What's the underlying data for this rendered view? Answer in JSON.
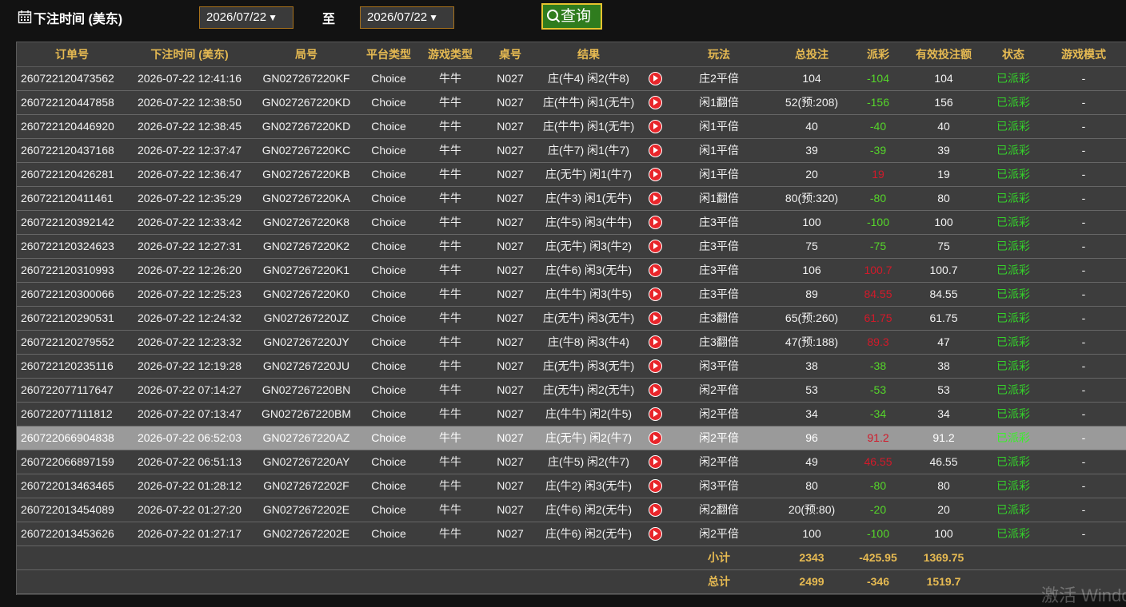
{
  "filter": {
    "label": "下注时间 (美东)",
    "start_date": "2026/07/22",
    "end_date": "2026/07/22",
    "to_label": "至",
    "query_label": "查询"
  },
  "table": {
    "headers": [
      "订单号",
      "下注时间 (美东)",
      "局号",
      "平台类型",
      "游戏类型",
      "桌号",
      "结果",
      "",
      "玩法",
      "总投注",
      "派彩",
      "有效投注额",
      "状态",
      "游戏模式"
    ],
    "rows": [
      {
        "order": "260722120473562",
        "time": "2026-07-22 12:41:16",
        "round": "GN027267220KF",
        "platform": "Choice",
        "game": "牛牛",
        "table": "N027",
        "result": "庄(牛4) 闲2(牛8)",
        "play": "庄2平倍",
        "bet": "104",
        "payout": "-104",
        "payout_color": "green",
        "valid": "104",
        "status": "已派彩",
        "mode": "-"
      },
      {
        "order": "260722120447858",
        "time": "2026-07-22 12:38:50",
        "round": "GN027267220KD",
        "platform": "Choice",
        "game": "牛牛",
        "table": "N027",
        "result": "庄(牛牛) 闲1(无牛)",
        "play": "闲1翻倍",
        "bet": "52(预:208)",
        "payout": "-156",
        "payout_color": "green",
        "valid": "156",
        "status": "已派彩",
        "mode": "-"
      },
      {
        "order": "260722120446920",
        "time": "2026-07-22 12:38:45",
        "round": "GN027267220KD",
        "platform": "Choice",
        "game": "牛牛",
        "table": "N027",
        "result": "庄(牛牛) 闲1(无牛)",
        "play": "闲1平倍",
        "bet": "40",
        "payout": "-40",
        "payout_color": "green",
        "valid": "40",
        "status": "已派彩",
        "mode": "-"
      },
      {
        "order": "260722120437168",
        "time": "2026-07-22 12:37:47",
        "round": "GN027267220KC",
        "platform": "Choice",
        "game": "牛牛",
        "table": "N027",
        "result": "庄(牛7) 闲1(牛7)",
        "play": "闲1平倍",
        "bet": "39",
        "payout": "-39",
        "payout_color": "green",
        "valid": "39",
        "status": "已派彩",
        "mode": "-"
      },
      {
        "order": "260722120426281",
        "time": "2026-07-22 12:36:47",
        "round": "GN027267220KB",
        "platform": "Choice",
        "game": "牛牛",
        "table": "N027",
        "result": "庄(无牛) 闲1(牛7)",
        "play": "闲1平倍",
        "bet": "20",
        "payout": "19",
        "payout_color": "red",
        "valid": "19",
        "status": "已派彩",
        "mode": "-"
      },
      {
        "order": "260722120411461",
        "time": "2026-07-22 12:35:29",
        "round": "GN027267220KA",
        "platform": "Choice",
        "game": "牛牛",
        "table": "N027",
        "result": "庄(牛3) 闲1(无牛)",
        "play": "闲1翻倍",
        "bet": "80(预:320)",
        "payout": "-80",
        "payout_color": "green",
        "valid": "80",
        "status": "已派彩",
        "mode": "-"
      },
      {
        "order": "260722120392142",
        "time": "2026-07-22 12:33:42",
        "round": "GN027267220K8",
        "platform": "Choice",
        "game": "牛牛",
        "table": "N027",
        "result": "庄(牛5) 闲3(牛牛)",
        "play": "庄3平倍",
        "bet": "100",
        "payout": "-100",
        "payout_color": "green",
        "valid": "100",
        "status": "已派彩",
        "mode": "-"
      },
      {
        "order": "260722120324623",
        "time": "2026-07-22 12:27:31",
        "round": "GN027267220K2",
        "platform": "Choice",
        "game": "牛牛",
        "table": "N027",
        "result": "庄(无牛) 闲3(牛2)",
        "play": "庄3平倍",
        "bet": "75",
        "payout": "-75",
        "payout_color": "green",
        "valid": "75",
        "status": "已派彩",
        "mode": "-"
      },
      {
        "order": "260722120310993",
        "time": "2026-07-22 12:26:20",
        "round": "GN027267220K1",
        "platform": "Choice",
        "game": "牛牛",
        "table": "N027",
        "result": "庄(牛6) 闲3(无牛)",
        "play": "庄3平倍",
        "bet": "106",
        "payout": "100.7",
        "payout_color": "red",
        "valid": "100.7",
        "status": "已派彩",
        "mode": "-"
      },
      {
        "order": "260722120300066",
        "time": "2026-07-22 12:25:23",
        "round": "GN027267220K0",
        "platform": "Choice",
        "game": "牛牛",
        "table": "N027",
        "result": "庄(牛牛) 闲3(牛5)",
        "play": "庄3平倍",
        "bet": "89",
        "payout": "84.55",
        "payout_color": "red",
        "valid": "84.55",
        "status": "已派彩",
        "mode": "-"
      },
      {
        "order": "260722120290531",
        "time": "2026-07-22 12:24:32",
        "round": "GN027267220JZ",
        "platform": "Choice",
        "game": "牛牛",
        "table": "N027",
        "result": "庄(无牛) 闲3(无牛)",
        "play": "庄3翻倍",
        "bet": "65(预:260)",
        "payout": "61.75",
        "payout_color": "red",
        "valid": "61.75",
        "status": "已派彩",
        "mode": "-"
      },
      {
        "order": "260722120279552",
        "time": "2026-07-22 12:23:32",
        "round": "GN027267220JY",
        "platform": "Choice",
        "game": "牛牛",
        "table": "N027",
        "result": "庄(牛8) 闲3(牛4)",
        "play": "庄3翻倍",
        "bet": "47(预:188)",
        "payout": "89.3",
        "payout_color": "red",
        "valid": "47",
        "status": "已派彩",
        "mode": "-"
      },
      {
        "order": "260722120235116",
        "time": "2026-07-22 12:19:28",
        "round": "GN027267220JU",
        "platform": "Choice",
        "game": "牛牛",
        "table": "N027",
        "result": "庄(无牛) 闲3(无牛)",
        "play": "闲3平倍",
        "bet": "38",
        "payout": "-38",
        "payout_color": "green",
        "valid": "38",
        "status": "已派彩",
        "mode": "-"
      },
      {
        "order": "260722077117647",
        "time": "2026-07-22 07:14:27",
        "round": "GN027267220BN",
        "platform": "Choice",
        "game": "牛牛",
        "table": "N027",
        "result": "庄(无牛) 闲2(无牛)",
        "play": "闲2平倍",
        "bet": "53",
        "payout": "-53",
        "payout_color": "green",
        "valid": "53",
        "status": "已派彩",
        "mode": "-"
      },
      {
        "order": "260722077111812",
        "time": "2026-07-22 07:13:47",
        "round": "GN027267220BM",
        "platform": "Choice",
        "game": "牛牛",
        "table": "N027",
        "result": "庄(牛牛) 闲2(牛5)",
        "play": "闲2平倍",
        "bet": "34",
        "payout": "-34",
        "payout_color": "green",
        "valid": "34",
        "status": "已派彩",
        "mode": "-"
      },
      {
        "order": "260722066904838",
        "time": "2026-07-22 06:52:03",
        "round": "GN027267220AZ",
        "platform": "Choice",
        "game": "牛牛",
        "table": "N027",
        "result": "庄(无牛) 闲2(牛7)",
        "play": "闲2平倍",
        "bet": "96",
        "payout": "91.2",
        "payout_color": "red",
        "valid": "91.2",
        "status": "已派彩",
        "mode": "-",
        "selected": true
      },
      {
        "order": "260722066897159",
        "time": "2026-07-22 06:51:13",
        "round": "GN027267220AY",
        "platform": "Choice",
        "game": "牛牛",
        "table": "N027",
        "result": "庄(牛5) 闲2(牛7)",
        "play": "闲2平倍",
        "bet": "49",
        "payout": "46.55",
        "payout_color": "red",
        "valid": "46.55",
        "status": "已派彩",
        "mode": "-"
      },
      {
        "order": "260722013463465",
        "time": "2026-07-22 01:28:12",
        "round": "GN0272672202F",
        "platform": "Choice",
        "game": "牛牛",
        "table": "N027",
        "result": "庄(牛2) 闲3(无牛)",
        "play": "闲3平倍",
        "bet": "80",
        "payout": "-80",
        "payout_color": "green",
        "valid": "80",
        "status": "已派彩",
        "mode": "-"
      },
      {
        "order": "260722013454089",
        "time": "2026-07-22 01:27:20",
        "round": "GN0272672202E",
        "platform": "Choice",
        "game": "牛牛",
        "table": "N027",
        "result": "庄(牛6) 闲2(无牛)",
        "play": "闲2翻倍",
        "bet": "20(预:80)",
        "payout": "-20",
        "payout_color": "green",
        "valid": "20",
        "status": "已派彩",
        "mode": "-"
      },
      {
        "order": "260722013453626",
        "time": "2026-07-22 01:27:17",
        "round": "GN0272672202E",
        "platform": "Choice",
        "game": "牛牛",
        "table": "N027",
        "result": "庄(牛6) 闲2(无牛)",
        "play": "闲2平倍",
        "bet": "100",
        "payout": "-100",
        "payout_color": "green",
        "valid": "100",
        "status": "已派彩",
        "mode": "-"
      }
    ],
    "subtotal": {
      "label": "小计",
      "bet": "2343",
      "payout": "-425.95",
      "valid": "1369.75"
    },
    "total": {
      "label": "总计",
      "bet": "2499",
      "payout": "-346",
      "valid": "1519.7"
    }
  },
  "watermark": "激活 Windo",
  "colors": {
    "header_text": "#e6ba52",
    "payout_loss": "#55d62a",
    "payout_win": "#d11a2a",
    "status": "#34d12a",
    "date_border": "#a8721c",
    "query_bg": "#2f7c1e",
    "query_border": "#e6c32e"
  }
}
